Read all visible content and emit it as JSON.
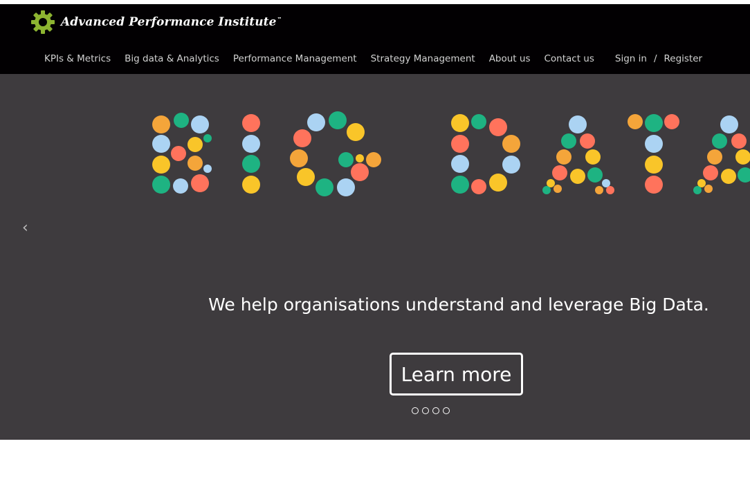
{
  "brand": {
    "name": "Advanced Performance Institute",
    "trademark": "™",
    "logo_icon": "gear-icon",
    "logo_color": "#8db431"
  },
  "nav": {
    "items": [
      {
        "label": "KPIs & Metrics"
      },
      {
        "label": "Big data & Analytics"
      },
      {
        "label": "Performance Management"
      },
      {
        "label": "Strategy Management"
      },
      {
        "label": "About us"
      },
      {
        "label": "Contact us"
      }
    ],
    "sign_in": "Sign in",
    "separator": "/",
    "register": "Register"
  },
  "hero": {
    "art_text": "BIG DATA",
    "tagline": "We help organisations understand and leverage Big Data.",
    "button_label": "Learn more",
    "prev_arrow": "‹",
    "slide_count": 4,
    "background": "#3e3b3e",
    "dot_colors": [
      "#f4a53a",
      "#1eb382",
      "#abd3f3",
      "#ff735c",
      "#f9c529"
    ]
  }
}
